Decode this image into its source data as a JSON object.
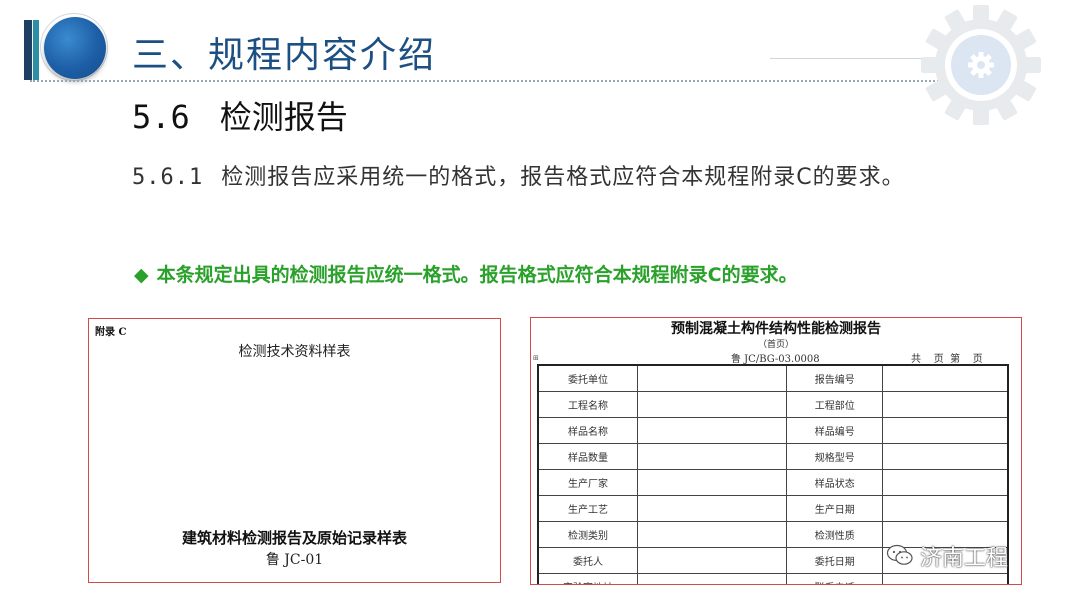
{
  "header": {
    "title": "三、规程内容介绍"
  },
  "section": {
    "number": "5.6",
    "title": "检测报告"
  },
  "clause": {
    "number": "5.6.1",
    "text": "检测报告应采用统一的格式，报告格式应符合本规程附录C的要求。"
  },
  "note": {
    "bullet": "◆",
    "text": "本条规定出具的检测报告应统一格式。报告格式应符合本规程附录C的要求。"
  },
  "left_doc": {
    "label": "附录 C",
    "title": "检测技术资料样表",
    "big_title": "建筑材料检测报告及原始记录样表",
    "code": "鲁 JC-01"
  },
  "right_doc": {
    "title": "预制混凝土构件结构性能检测报告",
    "subtitle": "（首页）",
    "code": "鲁 JC/BG-03.0008",
    "page_info": "共    页  第    页",
    "rows": [
      {
        "left": "委托单位",
        "right": "报告编号"
      },
      {
        "left": "工程名称",
        "right": "工程部位"
      },
      {
        "left": "样品名称",
        "right": "样品编号"
      },
      {
        "left": "样品数量",
        "right": "规格型号"
      },
      {
        "left": "生产厂家",
        "right": "样品状态"
      },
      {
        "left": "生产工艺",
        "right": "生产日期"
      },
      {
        "left": "检测类别",
        "right": "检测性质"
      },
      {
        "left": "委托人",
        "right": "委托日期"
      },
      {
        "left": "实验室地址",
        "right": "联系电话"
      }
    ]
  },
  "watermark": {
    "text": "济南工程"
  },
  "colors": {
    "header_title": "#1c4f82",
    "note_green": "#2aa12a",
    "doc_border": "#d24a4a"
  }
}
